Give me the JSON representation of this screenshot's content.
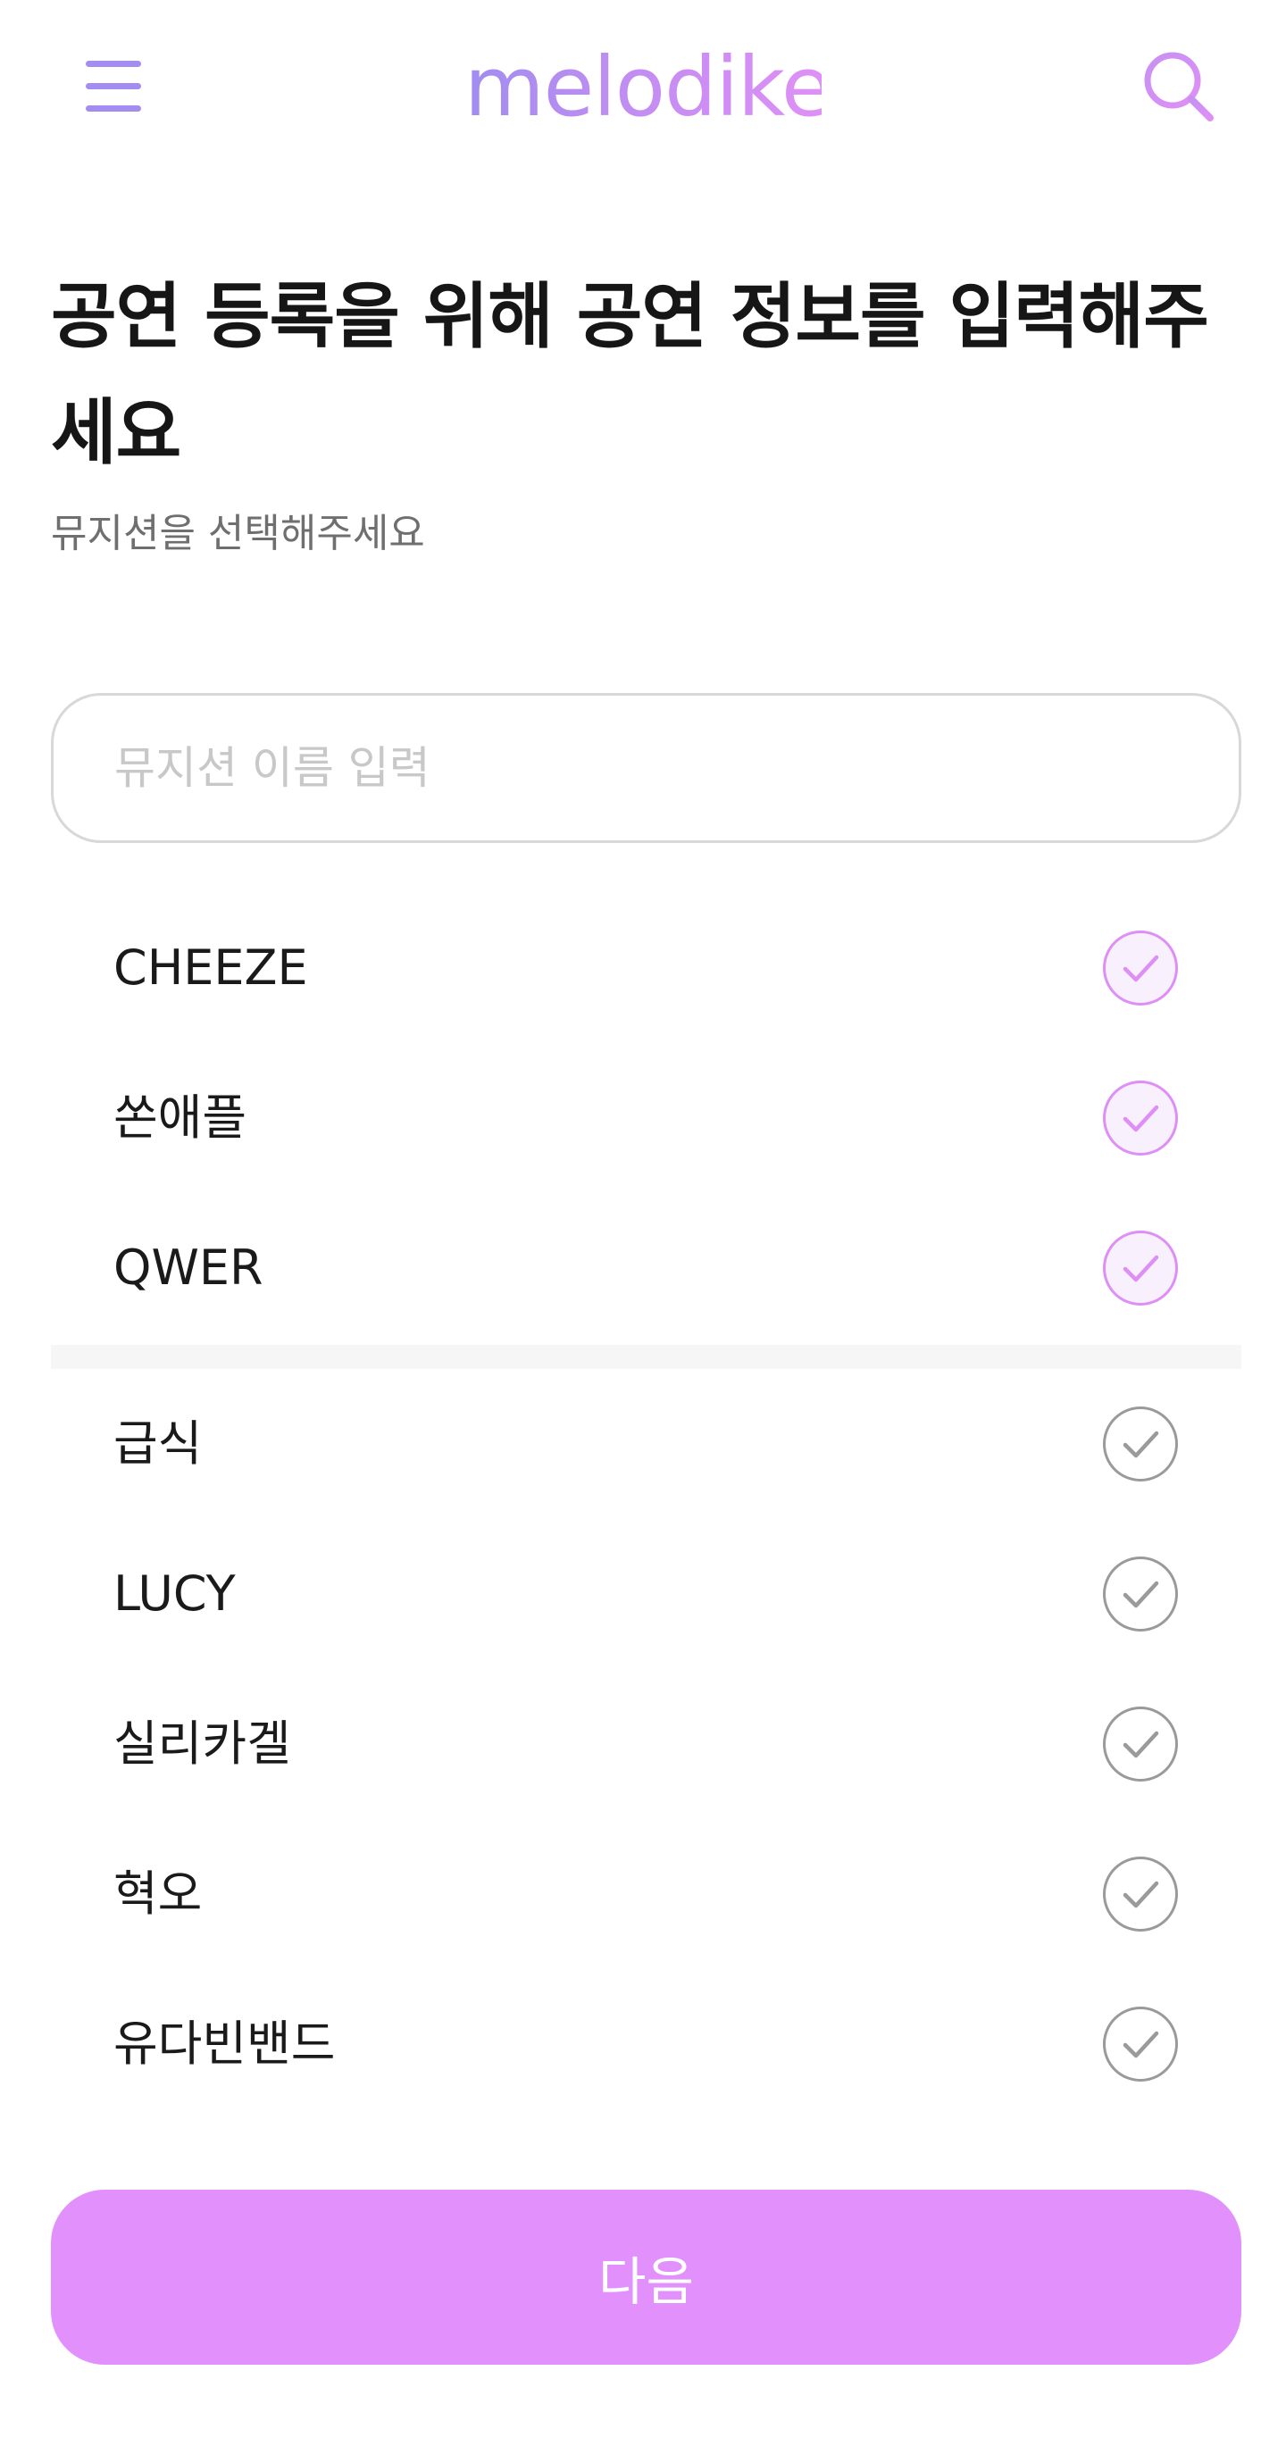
{
  "header": {
    "logo": "melodiket",
    "menu_icon": "hamburger-menu-icon",
    "search_icon": "search-icon",
    "brand_color": "#a48cf0",
    "brand_color_end": "#de90f6"
  },
  "headline": {
    "title": "공연 등록을 위해 공연 정보를 입력해주세요",
    "subtitle": "뮤지션을 선택해주세요"
  },
  "search": {
    "placeholder": "뮤지션 이름 입력",
    "value": ""
  },
  "selected_musicians": [
    {
      "name": "CHEEZE",
      "checked": true
    },
    {
      "name": "쏜애플",
      "checked": true
    },
    {
      "name": "QWER",
      "checked": true
    }
  ],
  "other_musicians": [
    {
      "name": "급식",
      "checked": false
    },
    {
      "name": "LUCY",
      "checked": false
    },
    {
      "name": "실리카겔",
      "checked": false
    },
    {
      "name": "혁오",
      "checked": false
    },
    {
      "name": "유다빈밴드",
      "checked": false
    }
  ],
  "check_colors": {
    "checked": "#de8ff6",
    "unchecked": "#9a9a9a"
  },
  "next_button": {
    "label": "다음",
    "color": "#e190fc"
  }
}
